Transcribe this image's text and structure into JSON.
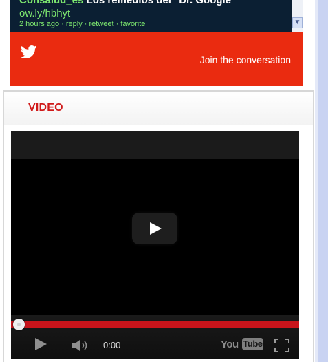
{
  "twitter": {
    "tweet": {
      "user": "Consalud_es",
      "text": "Los remedios del \"Dr. Google\"",
      "link": "ow.ly/hbhyt",
      "meta": "2 hours ago · reply · retweet · favorite"
    },
    "join_label": "Join the conversation",
    "bird_icon": "twitter-bird-icon",
    "scroll_arrow": "▼"
  },
  "video": {
    "section_title": "VIDEO",
    "player": {
      "current_time": "0:00",
      "progress_fraction": 0.0,
      "logo_you": "You",
      "logo_tube": "Tube"
    }
  },
  "colors": {
    "twitter_red": "#ea2b10",
    "timeline_bg": "#0b1f33",
    "tweet_green": "#7ee86f",
    "video_title_red": "#d01a1a",
    "progress_red": "#c8141b",
    "side_strip": "#c9d3f2"
  }
}
